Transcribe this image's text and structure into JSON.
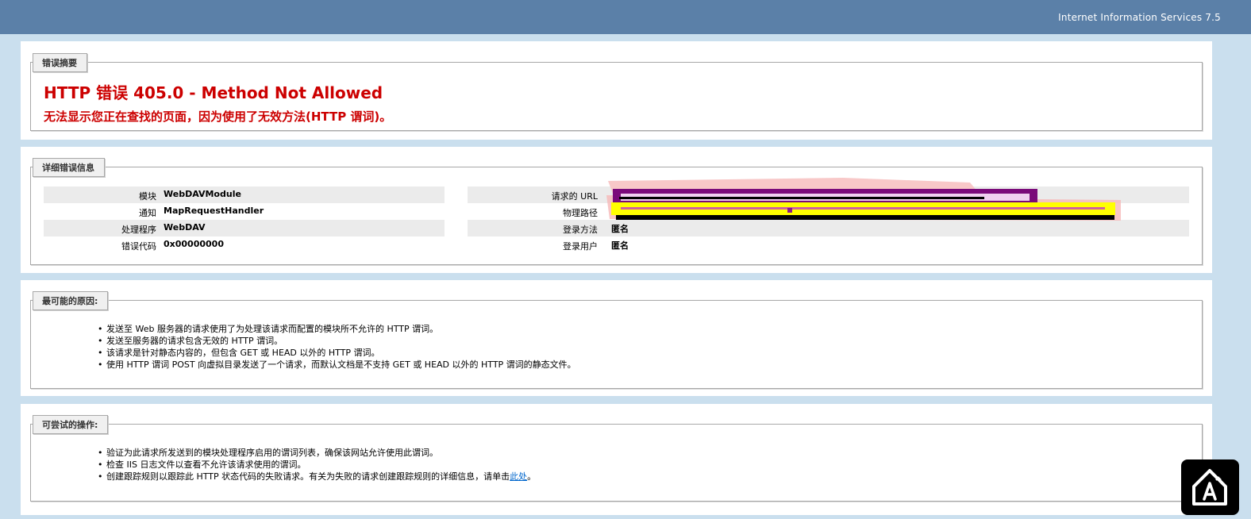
{
  "header": {
    "product": "Internet Information Services 7.5"
  },
  "summary": {
    "legend": "错误摘要",
    "title": "HTTP 错误 405.0 - Method Not Allowed",
    "subtitle": "无法显示您正在查找的页面，因为使用了无效方法(HTTP 谓词)。"
  },
  "details": {
    "legend": "详细错误信息",
    "left": [
      {
        "label": "模块",
        "value": "WebDAVModule"
      },
      {
        "label": "通知",
        "value": "MapRequestHandler"
      },
      {
        "label": "处理程序",
        "value": "WebDAV"
      },
      {
        "label": "错误代码",
        "value": "0x00000000"
      }
    ],
    "right": [
      {
        "label": "请求的 URL",
        "value": ""
      },
      {
        "label": "物理路径",
        "value": ""
      },
      {
        "label": "登录方法",
        "value": "匿名"
      },
      {
        "label": "登录用户",
        "value": "匿名"
      }
    ]
  },
  "causes": {
    "legend": "最可能的原因:",
    "items": [
      "发送至 Web 服务器的请求使用了为处理该请求而配置的模块所不允许的 HTTP 谓词。",
      "发送至服务器的请求包含无效的 HTTP 谓词。",
      "该请求是针对静态内容的，但包含 GET 或 HEAD 以外的 HTTP 谓词。",
      "使用 HTTP 谓词 POST 向虚拟目录发送了一个请求，而默认文档是不支持 GET 或 HEAD 以外的 HTTP 谓词的静态文件。"
    ]
  },
  "actions": {
    "legend": "可尝试的操作:",
    "items": [
      "验证为此请求所发送到的模块处理程序启用的谓词列表，确保该网站允许使用此谓词。",
      "检查 IIS 日志文件以查看不允许该请求使用的谓词。"
    ],
    "last_prefix": "创建跟踪规则以跟踪此 HTTP 状态代码的失败请求。有关为失败的请求创建跟踪规则的详细信息，请单击",
    "link_text": "此处",
    "last_suffix": "。"
  },
  "colors": {
    "header": "#5b80a8",
    "background": "#cadfee",
    "error_red": "#cc0000",
    "link": "#0066cc"
  },
  "icons": {
    "floating_button": "accessibility-logo-icon"
  }
}
